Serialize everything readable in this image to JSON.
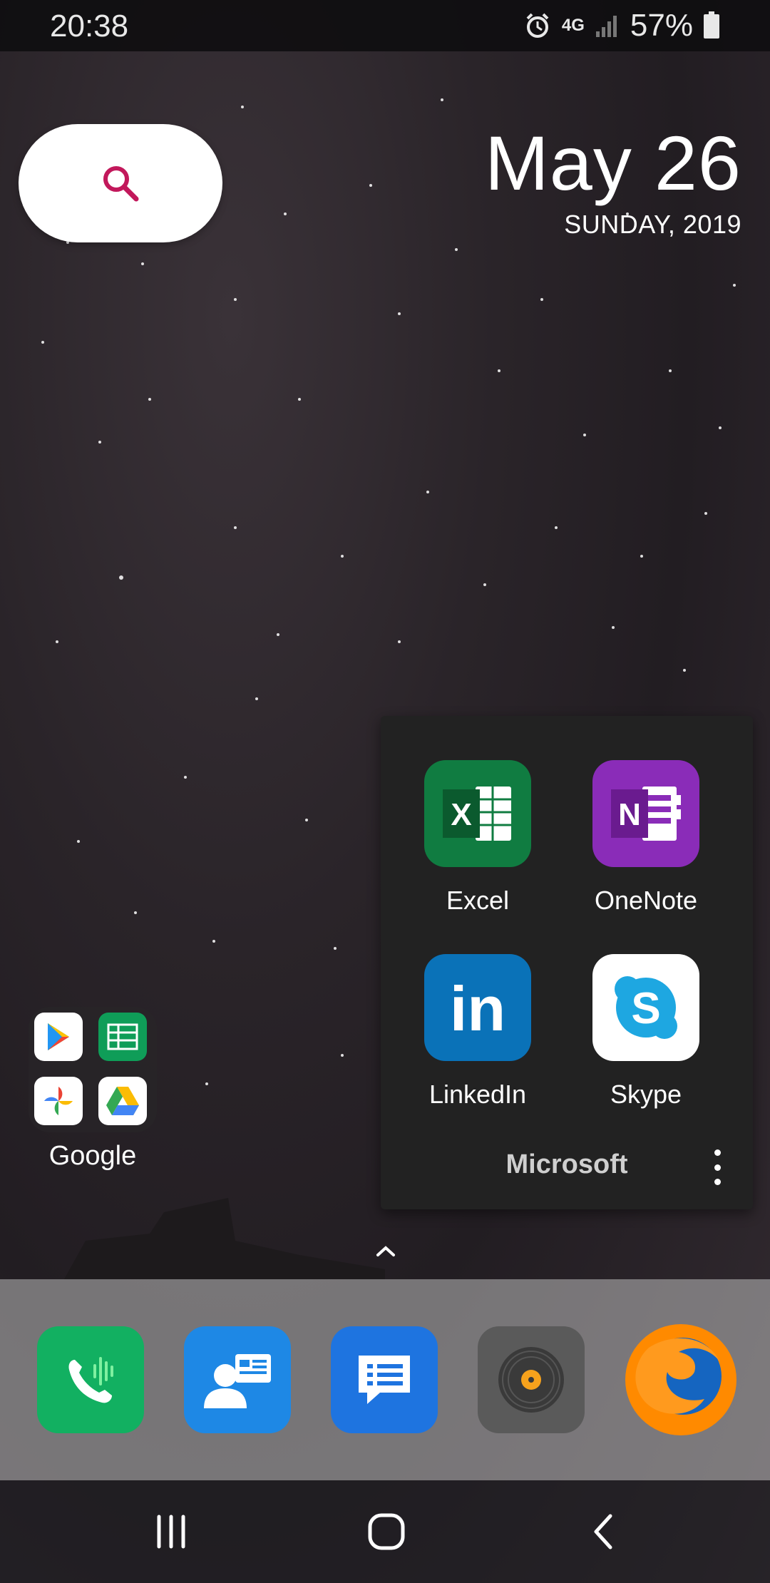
{
  "status_bar": {
    "time": "20:38",
    "network": "4G",
    "battery": "57%"
  },
  "date_widget": {
    "date": "May 26",
    "day": "SUNDAY, 2019"
  },
  "microsoft_folder": {
    "name": "Microsoft",
    "apps": [
      {
        "label": "Excel",
        "icon": "excel-icon",
        "color": "#107c41"
      },
      {
        "label": "OneNote",
        "icon": "onenote-icon",
        "color": "#8a2cb8"
      },
      {
        "label": "LinkedIn",
        "icon": "linkedin-icon",
        "color": "#0a72b8"
      },
      {
        "label": "Skype",
        "icon": "skype-icon",
        "color": "#1ea7e1"
      }
    ]
  },
  "google_folder": {
    "label": "Google",
    "apps": [
      "play-store-icon",
      "sheets-icon",
      "photos-icon",
      "drive-icon"
    ]
  },
  "dock": {
    "apps": [
      "phone-icon",
      "contacts-icon",
      "messages-icon",
      "music-icon",
      "firefox-icon"
    ]
  },
  "colors": {
    "search_accent": "#c2185b"
  }
}
